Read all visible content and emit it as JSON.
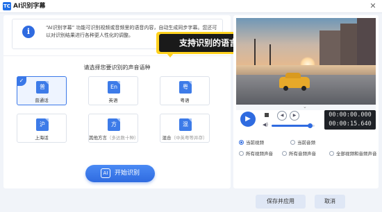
{
  "window": {
    "logo_text": "TC",
    "title": "AI识别字幕",
    "close_glyph": "✕"
  },
  "info": {
    "icon_glyph": "i",
    "text": "“AI识别字幕” 功能可识别视频或音频里的语音内容，自动生成同步字幕。您还可以对识别结果进行各种更人性化的调整。"
  },
  "callout": {
    "text": "支持识别的语言多"
  },
  "languages": {
    "section_title": "请选择您要识别的声音语种",
    "items": [
      {
        "icon_text": "普",
        "label": "普通话",
        "sub": "",
        "selected": true
      },
      {
        "icon_text": "En",
        "label": "英语",
        "sub": "",
        "selected": false
      },
      {
        "icon_text": "粤",
        "label": "粤语",
        "sub": "",
        "selected": false
      },
      {
        "icon_text": "沪",
        "label": "上海话",
        "sub": "",
        "selected": false
      },
      {
        "icon_text": "方",
        "label": "其他方言",
        "sub": "（多达数十种）",
        "selected": false
      },
      {
        "icon_text": "混",
        "label": "混合",
        "sub": "（中英粤等并存）",
        "selected": false
      }
    ],
    "check_glyph": "✓"
  },
  "start_button": {
    "icon_glyph": "AI",
    "label": "开始识别"
  },
  "player": {
    "play_glyph": "▶",
    "prev_glyph": "◀",
    "next_glyph": "▶",
    "volume_glyph": "◀)",
    "volume_fraction": 0.9,
    "current_time": "00:00:00.000",
    "total_time": "00:00:15.640"
  },
  "options": [
    {
      "label": "当前视频",
      "selected": true
    },
    {
      "label": "当前音频",
      "selected": false
    },
    {
      "label": "所有视频声音",
      "selected": false
    },
    {
      "label": "所有音频声音",
      "selected": false
    },
    {
      "label": "全部视频和音频声音",
      "selected": false
    }
  ],
  "footer": {
    "save_label": "保存并应用",
    "cancel_label": "取消"
  },
  "colors": {
    "accent": "#2f6be0",
    "callout_border": "#ffd21f",
    "callout_fill": "#1a1a1a",
    "selected_card_bg": "#eef4ff"
  }
}
